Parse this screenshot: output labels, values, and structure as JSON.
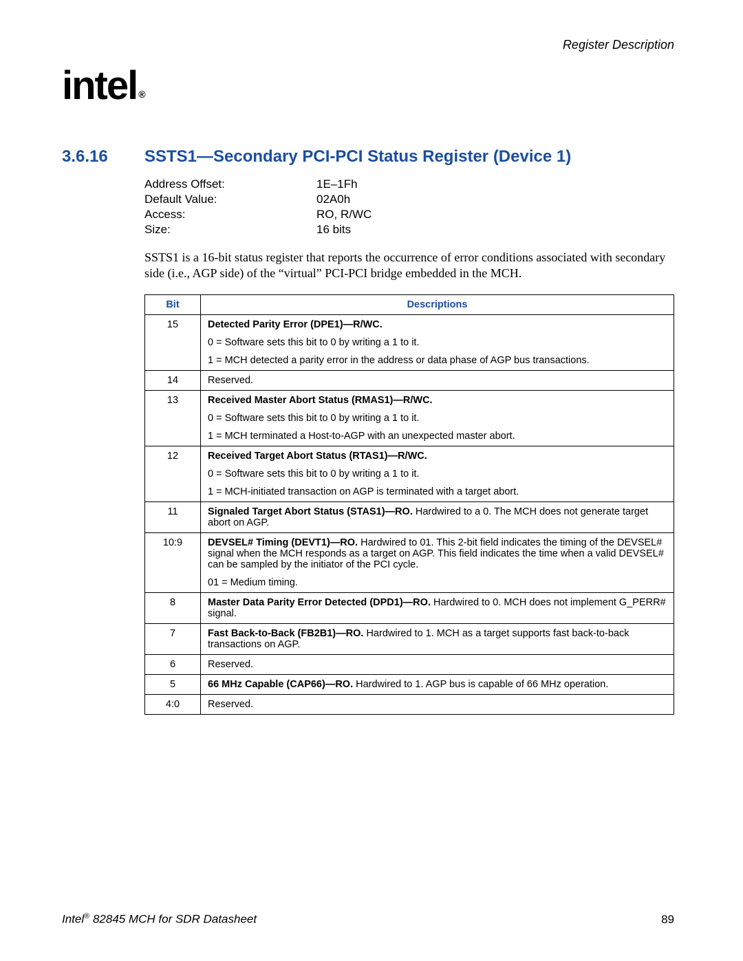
{
  "running_head": "Register Description",
  "logo_text": "intel",
  "logo_reg": "®",
  "section": {
    "number": "3.6.16",
    "title": "SSTS1—Secondary PCI-PCI Status Register (Device 1)"
  },
  "attrs": [
    {
      "label": "Address Offset:",
      "value": "1E–1Fh"
    },
    {
      "label": "Default Value:",
      "value": "02A0h"
    },
    {
      "label": "Access:",
      "value": "RO, R/WC"
    },
    {
      "label": "Size:",
      "value": "16 bits"
    }
  ],
  "paragraph": "SSTS1 is a 16-bit status register that reports the occurrence of error conditions associated with secondary side (i.e., AGP side) of the “virtual” PCI-PCI bridge embedded in the MCH.",
  "table": {
    "headers": {
      "bit": "Bit",
      "desc": "Descriptions"
    },
    "rows": [
      {
        "bit": "15",
        "paras": [
          {
            "bold": "Detected Parity Error (DPE1)—R/WC.",
            "rest": ""
          },
          {
            "bold": "",
            "rest": "0 = Software sets this bit to 0 by writing a 1 to it."
          },
          {
            "bold": "",
            "rest": "1 = MCH detected a parity error in the address or data phase of AGP bus transactions."
          }
        ]
      },
      {
        "bit": "14",
        "paras": [
          {
            "bold": "",
            "rest": "Reserved."
          }
        ]
      },
      {
        "bit": "13",
        "paras": [
          {
            "bold": "Received Master Abort Status (RMAS1)—R/WC.",
            "rest": ""
          },
          {
            "bold": "",
            "rest": "0 = Software sets this bit to 0 by writing a 1 to it."
          },
          {
            "bold": "",
            "rest": "1 = MCH terminated a Host-to-AGP with an unexpected master abort."
          }
        ]
      },
      {
        "bit": "12",
        "paras": [
          {
            "bold": "Received Target Abort Status (RTAS1)—R/WC.",
            "rest": ""
          },
          {
            "bold": "",
            "rest": "0 = Software sets this bit to 0 by writing a 1 to it."
          },
          {
            "bold": "",
            "rest": "1 = MCH-initiated transaction on AGP is terminated with a target abort."
          }
        ]
      },
      {
        "bit": "11",
        "paras": [
          {
            "bold": "Signaled Target Abort Status (STAS1)—RO.",
            "rest": " Hardwired to a 0. The MCH does not generate target abort on AGP."
          }
        ]
      },
      {
        "bit": "10:9",
        "paras": [
          {
            "bold": "DEVSEL# Timing (DEVT1)—RO.",
            "rest": " Hardwired to 01. This 2-bit field indicates the timing of the DEVSEL# signal when the MCH responds as a target on AGP. This field indicates the time when a valid DEVSEL# can be sampled by the initiator of the PCI cycle."
          },
          {
            "bold": "",
            "rest": "01 = Medium timing."
          }
        ]
      },
      {
        "bit": "8",
        "paras": [
          {
            "bold": "Master Data Parity Error Detected (DPD1)—RO.",
            "rest": " Hardwired to 0. MCH does not implement G_PERR# signal."
          }
        ]
      },
      {
        "bit": "7",
        "paras": [
          {
            "bold": "Fast Back-to-Back (FB2B1)—RO.",
            "rest": " Hardwired to 1. MCH as a target supports fast back-to-back transactions on AGP."
          }
        ]
      },
      {
        "bit": "6",
        "paras": [
          {
            "bold": "",
            "rest": "Reserved."
          }
        ]
      },
      {
        "bit": "5",
        "paras": [
          {
            "bold": "66 MHz Capable (CAP66)—RO.",
            "rest": " Hardwired to 1. AGP bus is capable of 66 MHz operation."
          }
        ]
      },
      {
        "bit": "4:0",
        "paras": [
          {
            "bold": "",
            "rest": "Reserved."
          }
        ]
      }
    ]
  },
  "footer": {
    "left_prefix": "Intel",
    "left_sup": "®",
    "left_rest": " 82845 MCH for SDR Datasheet",
    "page": "89"
  }
}
